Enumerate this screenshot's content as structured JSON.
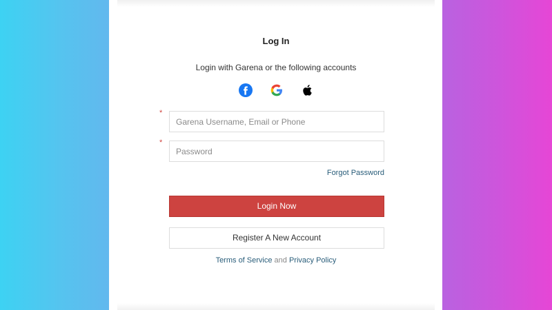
{
  "login": {
    "title": "Log In",
    "subtitle": "Login with Garena or the following accounts",
    "social": [
      {
        "icon": "facebook-icon",
        "color": "#1877f2"
      },
      {
        "icon": "google-icon"
      },
      {
        "icon": "apple-icon",
        "color": "#000000"
      }
    ],
    "required_mark": "*",
    "username": {
      "placeholder": "Garena Username, Email or Phone",
      "value": ""
    },
    "password": {
      "placeholder": "Password",
      "value": ""
    },
    "forgot_password": "Forgot Password",
    "login_button": "Login Now",
    "register_button": "Register A New Account",
    "terms": "Terms of Service",
    "and": "and",
    "privacy": "Privacy Policy"
  },
  "colors": {
    "accent_red": "#cd4340",
    "link": "#285c79",
    "bg_left": "#3dd2f3",
    "bg_right": "#e646d6"
  }
}
